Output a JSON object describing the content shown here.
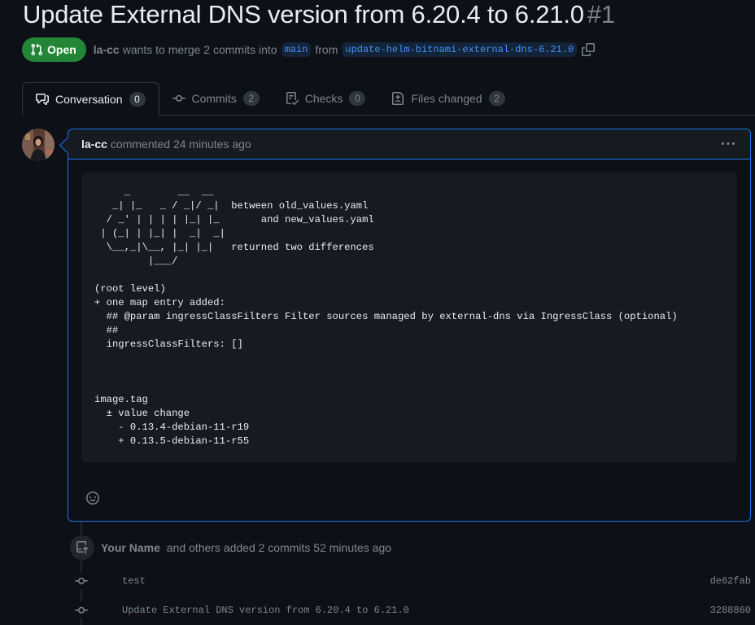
{
  "pr": {
    "title": "Update External DNS version from 6.20.4 to 6.21.0",
    "number": "#1",
    "state": "Open",
    "author": "la-cc",
    "meta_text": "wants to merge 2 commits into",
    "base_branch": "main",
    "from_text": "from",
    "head_branch": "update-helm-bitnami-external-dns-6.21.0"
  },
  "tabs": [
    {
      "label": "Conversation",
      "count": "0",
      "icon": "comment-discussion-icon"
    },
    {
      "label": "Commits",
      "count": "2",
      "icon": "git-commit-icon"
    },
    {
      "label": "Checks",
      "count": "0",
      "icon": "checklist-icon"
    },
    {
      "label": "Files changed",
      "count": "2",
      "icon": "file-diff-icon"
    }
  ],
  "comment": {
    "author": "la-cc",
    "meta": "commented 24 minutes ago",
    "body": "     _        __  __\n   _| |_   _ / _|/ _|  between old_values.yaml\n  / _' | | | | |_| |_       and new_values.yaml\n | (_| | |_| |  _|  _|\n  \\__,_|\\__, |_| |_|   returned two differences\n         |___/\n\n(root level)\n+ one map entry added:\n  ## @param ingressClassFilters Filter sources managed by external-dns via IngressClass (optional)\n  ##\n  ingressClassFilters: []\n\n\n\nimage.tag\n  ± value change\n    - 0.13.4-debian-11-r19\n    + 0.13.5-debian-11-r55"
  },
  "timeline": {
    "author": "Your Name",
    "text": "and others added 2 commits 52 minutes ago",
    "commits": [
      {
        "message": "test",
        "sha": "de62fab"
      },
      {
        "message": "Update External DNS version from 6.20.4 to 6.21.0",
        "sha": "3288860"
      }
    ]
  },
  "colors": {
    "background": "#0d1117",
    "open_badge": "#238636",
    "accent_border": "#1f6feb",
    "branch_text": "#4493f8"
  }
}
